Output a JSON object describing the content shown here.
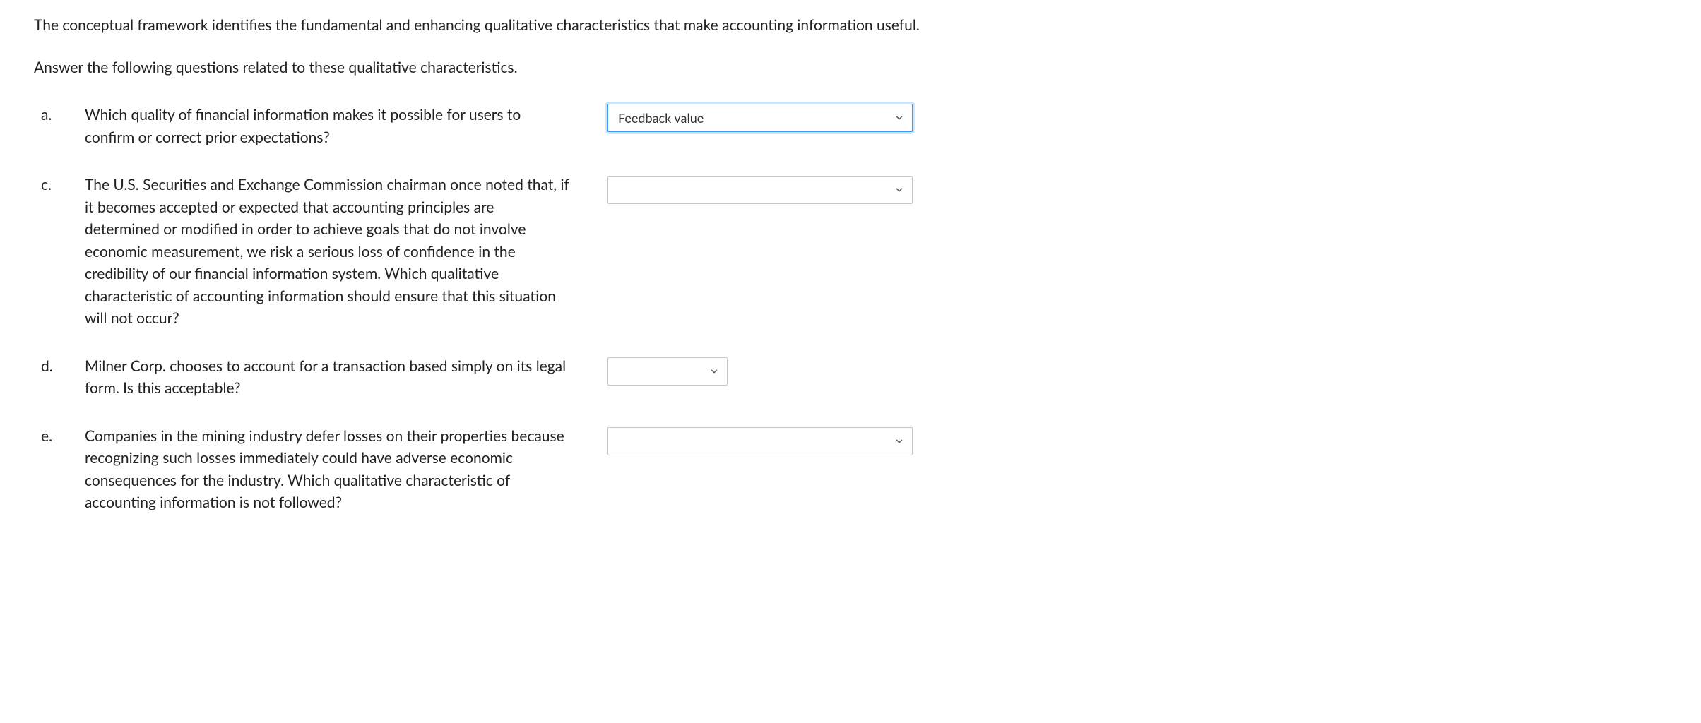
{
  "intro": {
    "line1": "The conceptual framework identifies the fundamental and enhancing qualitative characteristics that make accounting information useful."
  },
  "prompt": "Answer the following questions related to these qualitative characteristics.",
  "questions": [
    {
      "label": "a.",
      "text": "Which quality of financial information makes it possible for users to confirm or correct prior expectations?",
      "select_value": "Feedback value",
      "size": "a",
      "focused": true
    },
    {
      "label": "c.",
      "text": "The U.S. Securities and Exchange Commission chairman once noted that, if it becomes accepted or expected that accounting principles are determined or modified in order to achieve goals that do not involve economic measurement, we risk a serious loss of confidence in the credibility of our financial information system. Which qualitative characteristic of accounting information should ensure that this situation will not occur?",
      "select_value": "",
      "size": "c",
      "focused": false
    },
    {
      "label": "d.",
      "text": "Milner Corp. chooses to account for a transaction based simply on its legal form. Is this acceptable?",
      "select_value": "",
      "size": "d",
      "focused": false
    },
    {
      "label": "e.",
      "text": "Companies in the mining industry defer losses on their properties because recognizing such losses immediately could have adverse economic consequences for the industry. Which qualitative characteristic of accounting information is not followed?",
      "select_value": "",
      "size": "e",
      "focused": false
    }
  ]
}
